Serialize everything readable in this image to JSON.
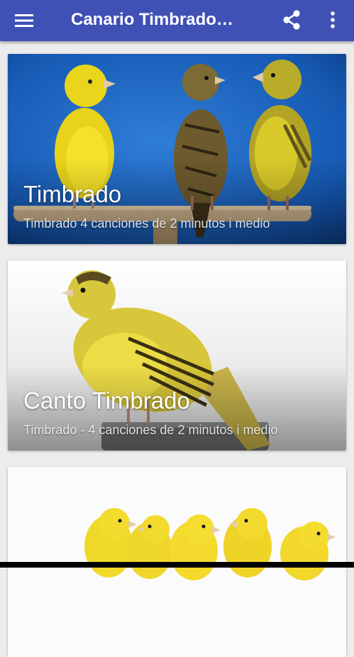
{
  "appbar": {
    "title": "Canario Timbrado…",
    "menu_icon": "hamburger-menu-icon",
    "share_icon": "share-icon",
    "more_icon": "more-vert-icon",
    "color": "#3f51b5"
  },
  "cards": [
    {
      "title": "Timbrado",
      "subtitle": "Timbrado 4 canciones de 2 minutos i medio",
      "image": "three-canaries-on-perch-blue-background"
    },
    {
      "title": "Canto Timbrado",
      "subtitle": "Timbrado - 4 canciones de 2 minutos i medio",
      "image": "single-canary-on-pot"
    },
    {
      "title": "",
      "subtitle": "",
      "image": "row-of-yellow-canaries"
    }
  ]
}
